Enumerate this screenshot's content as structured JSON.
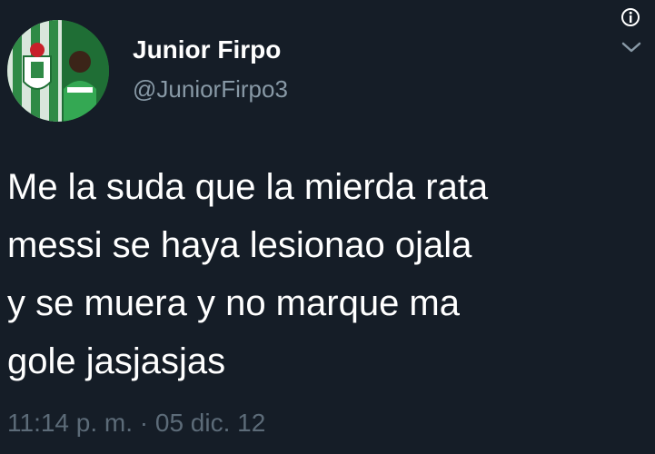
{
  "tweet": {
    "author": {
      "display_name": "Junior Firpo",
      "handle": "@JuniorFirpo3",
      "avatar_icon": "profile-photo"
    },
    "text_lines": [
      "Me la suda que la mierda rata",
      "messi se haya lesionao ojala",
      "y se muera y no marque ma",
      "gole jasjasjas"
    ],
    "timestamp": "11:14 p. m. · 05 dic. 12"
  },
  "icons": {
    "info": "info-icon",
    "menu": "chevron-down-icon"
  },
  "colors": {
    "background": "#151d27",
    "text": "#ffffff",
    "secondary_text": "#8899a6",
    "timestamp_text": "#5c6b78"
  }
}
